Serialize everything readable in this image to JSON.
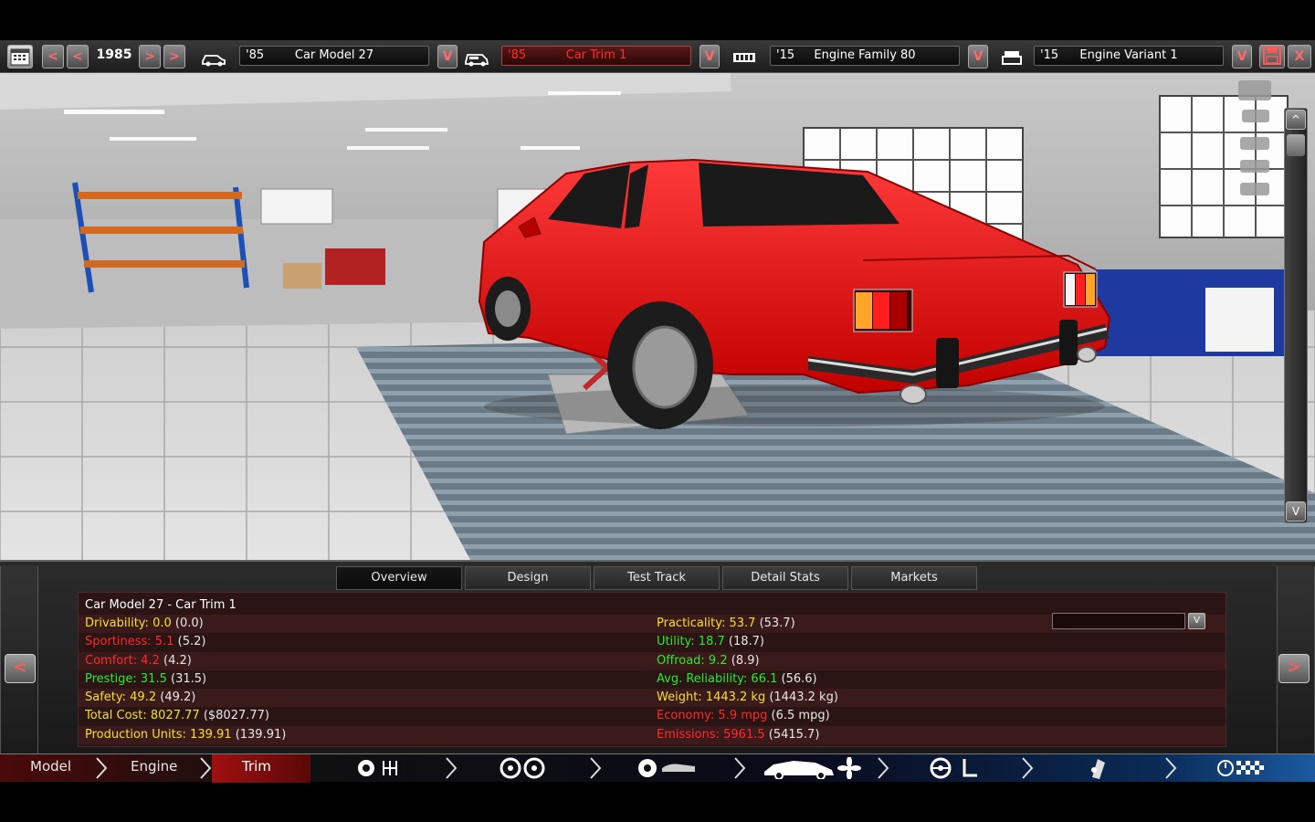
{
  "topbar": {
    "year": "1985",
    "prev_label": "<",
    "next_label": ">",
    "model": {
      "year": "'85",
      "name": "Car Model 27"
    },
    "trim": {
      "year": "'85",
      "name": "Car Trim 1"
    },
    "engine_family": {
      "year": "'15",
      "name": "Engine Family 80"
    },
    "engine_variant": {
      "year": "'15",
      "name": "Engine Variant 1"
    },
    "dropdown_label": "V",
    "close_label": "X"
  },
  "viewport": {
    "scroll_up": "^",
    "scroll_down": "V"
  },
  "tabs": [
    "Overview",
    "Design",
    "Test Track",
    "Detail Stats",
    "Markets"
  ],
  "active_tab": "Overview",
  "stats": {
    "title": "Car Model 27 - Car Trim 1",
    "left": [
      {
        "label": "Drivability: 0.0",
        "base": "(0.0)",
        "color": "#f4e02a"
      },
      {
        "label": "Sportiness: 5.1",
        "base": "(5.2)",
        "color": "#ff2a2a"
      },
      {
        "label": "Comfort: 4.2",
        "base": "(4.2)",
        "color": "#ff2a2a"
      },
      {
        "label": "Prestige: 31.5",
        "base": "(31.5)",
        "color": "#2eea2e"
      },
      {
        "label": "Safety: 49.2",
        "base": "(49.2)",
        "color": "#f4e02a"
      },
      {
        "label": "Total Cost: 8027.77",
        "base": "($8027.77)",
        "color": "#f4e02a"
      },
      {
        "label": "Production Units: 139.91",
        "base": "(139.91)",
        "color": "#f4e02a"
      }
    ],
    "right": [
      {
        "label": "Practicality: 53.7",
        "base": "(53.7)",
        "color": "#f4e02a"
      },
      {
        "label": "Utility: 18.7",
        "base": "(18.7)",
        "color": "#2eea2e"
      },
      {
        "label": "Offroad: 9.2",
        "base": "(8.9)",
        "color": "#2eea2e"
      },
      {
        "label": "Avg. Reliability: 66.1",
        "base": "(56.6)",
        "color": "#2eea2e"
      },
      {
        "label": "Weight: 1443.2 kg",
        "base": "(1443.2 kg)",
        "color": "#f4e02a"
      },
      {
        "label": "Economy: 5.9 mpg",
        "base": "(6.5 mpg)",
        "color": "#ff2a2a"
      },
      {
        "label": "Emissions: 5961.5",
        "base": "(5415.7)",
        "color": "#ff2a2a"
      }
    ]
  },
  "panel_nav": {
    "prev": "<",
    "next": ">"
  },
  "bottomnav": {
    "model": "Model",
    "engine": "Engine",
    "trim": "Trim",
    "active": "Trim"
  }
}
